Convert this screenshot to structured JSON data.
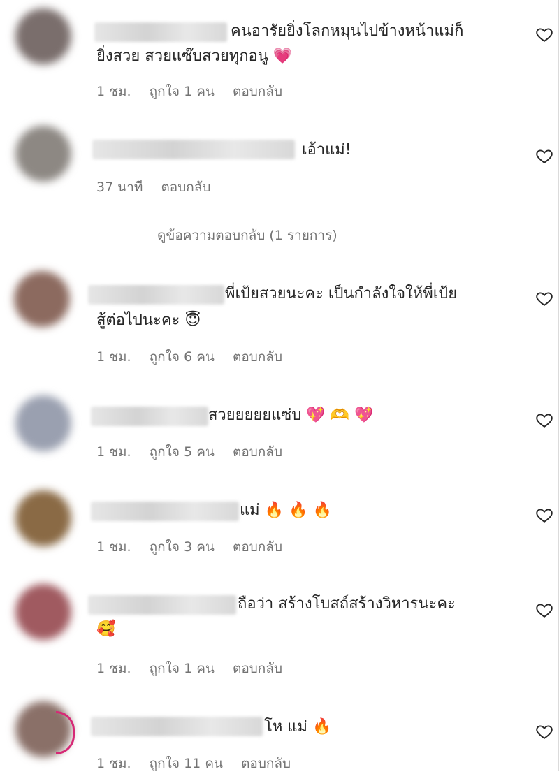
{
  "comments": [
    {
      "text_line1": "คนอารัยยิ่งโลกหมุนไปข้างหน้าแม่ก็",
      "text_line2": "ยิ่งสวย สวยแซ๊บสวยทุกอนู 💗",
      "time": "1 ชม.",
      "likes": "ถูกใจ 1 คน",
      "reply": "ตอบกลับ",
      "avatar_color": "#7a6e6c"
    },
    {
      "text_line1": "เอ้าแม่!",
      "text_line2": "",
      "time": "37 นาที",
      "likes": "",
      "reply": "ตอบกลับ",
      "avatar_color": "#8d8883"
    },
    {
      "text_line1": "พี่เป้ยสวยนะคะ เป็นกำลังใจให้พี่เป้ย",
      "text_line2": "สู้ต่อไปนะคะ 😇",
      "time": "1 ชม.",
      "likes": "ถูกใจ 6 คน",
      "reply": "ตอบกลับ",
      "avatar_color": "#8c6a5f"
    },
    {
      "text_line1": "สวยยยยยแซ่บ 💖 🫶 💖",
      "text_line2": "",
      "time": "1 ชม.",
      "likes": "ถูกใจ 5 คน",
      "reply": "ตอบกลับ",
      "avatar_color": "#9aa0b0"
    },
    {
      "text_line1": "แม่ 🔥 🔥 🔥",
      "text_line2": "",
      "time": "1 ชม.",
      "likes": "ถูกใจ 3 คน",
      "reply": "ตอบกลับ",
      "avatar_color": "#8a6a45"
    },
    {
      "text_line1": "ถือว่า สร้างโบสถ์สร้างวิหารนะคะ",
      "text_line2": "🥰",
      "time": "1 ชม.",
      "likes": "ถูกใจ 1 คน",
      "reply": "ตอบกลับ",
      "avatar_color": "#a05a60"
    },
    {
      "text_line1": "โห แม่ 🔥",
      "text_line2": "",
      "time": "1 ชม.",
      "likes": "ถูกใจ 11 คน",
      "reply": "ตอบกลับ",
      "avatar_color": "#8a7068"
    }
  ],
  "view_replies": "ดูข้อความตอบกลับ (1 รายการ)",
  "colors": {
    "text": "#262626",
    "meta": "#737373",
    "story_ring": "#d62976"
  }
}
